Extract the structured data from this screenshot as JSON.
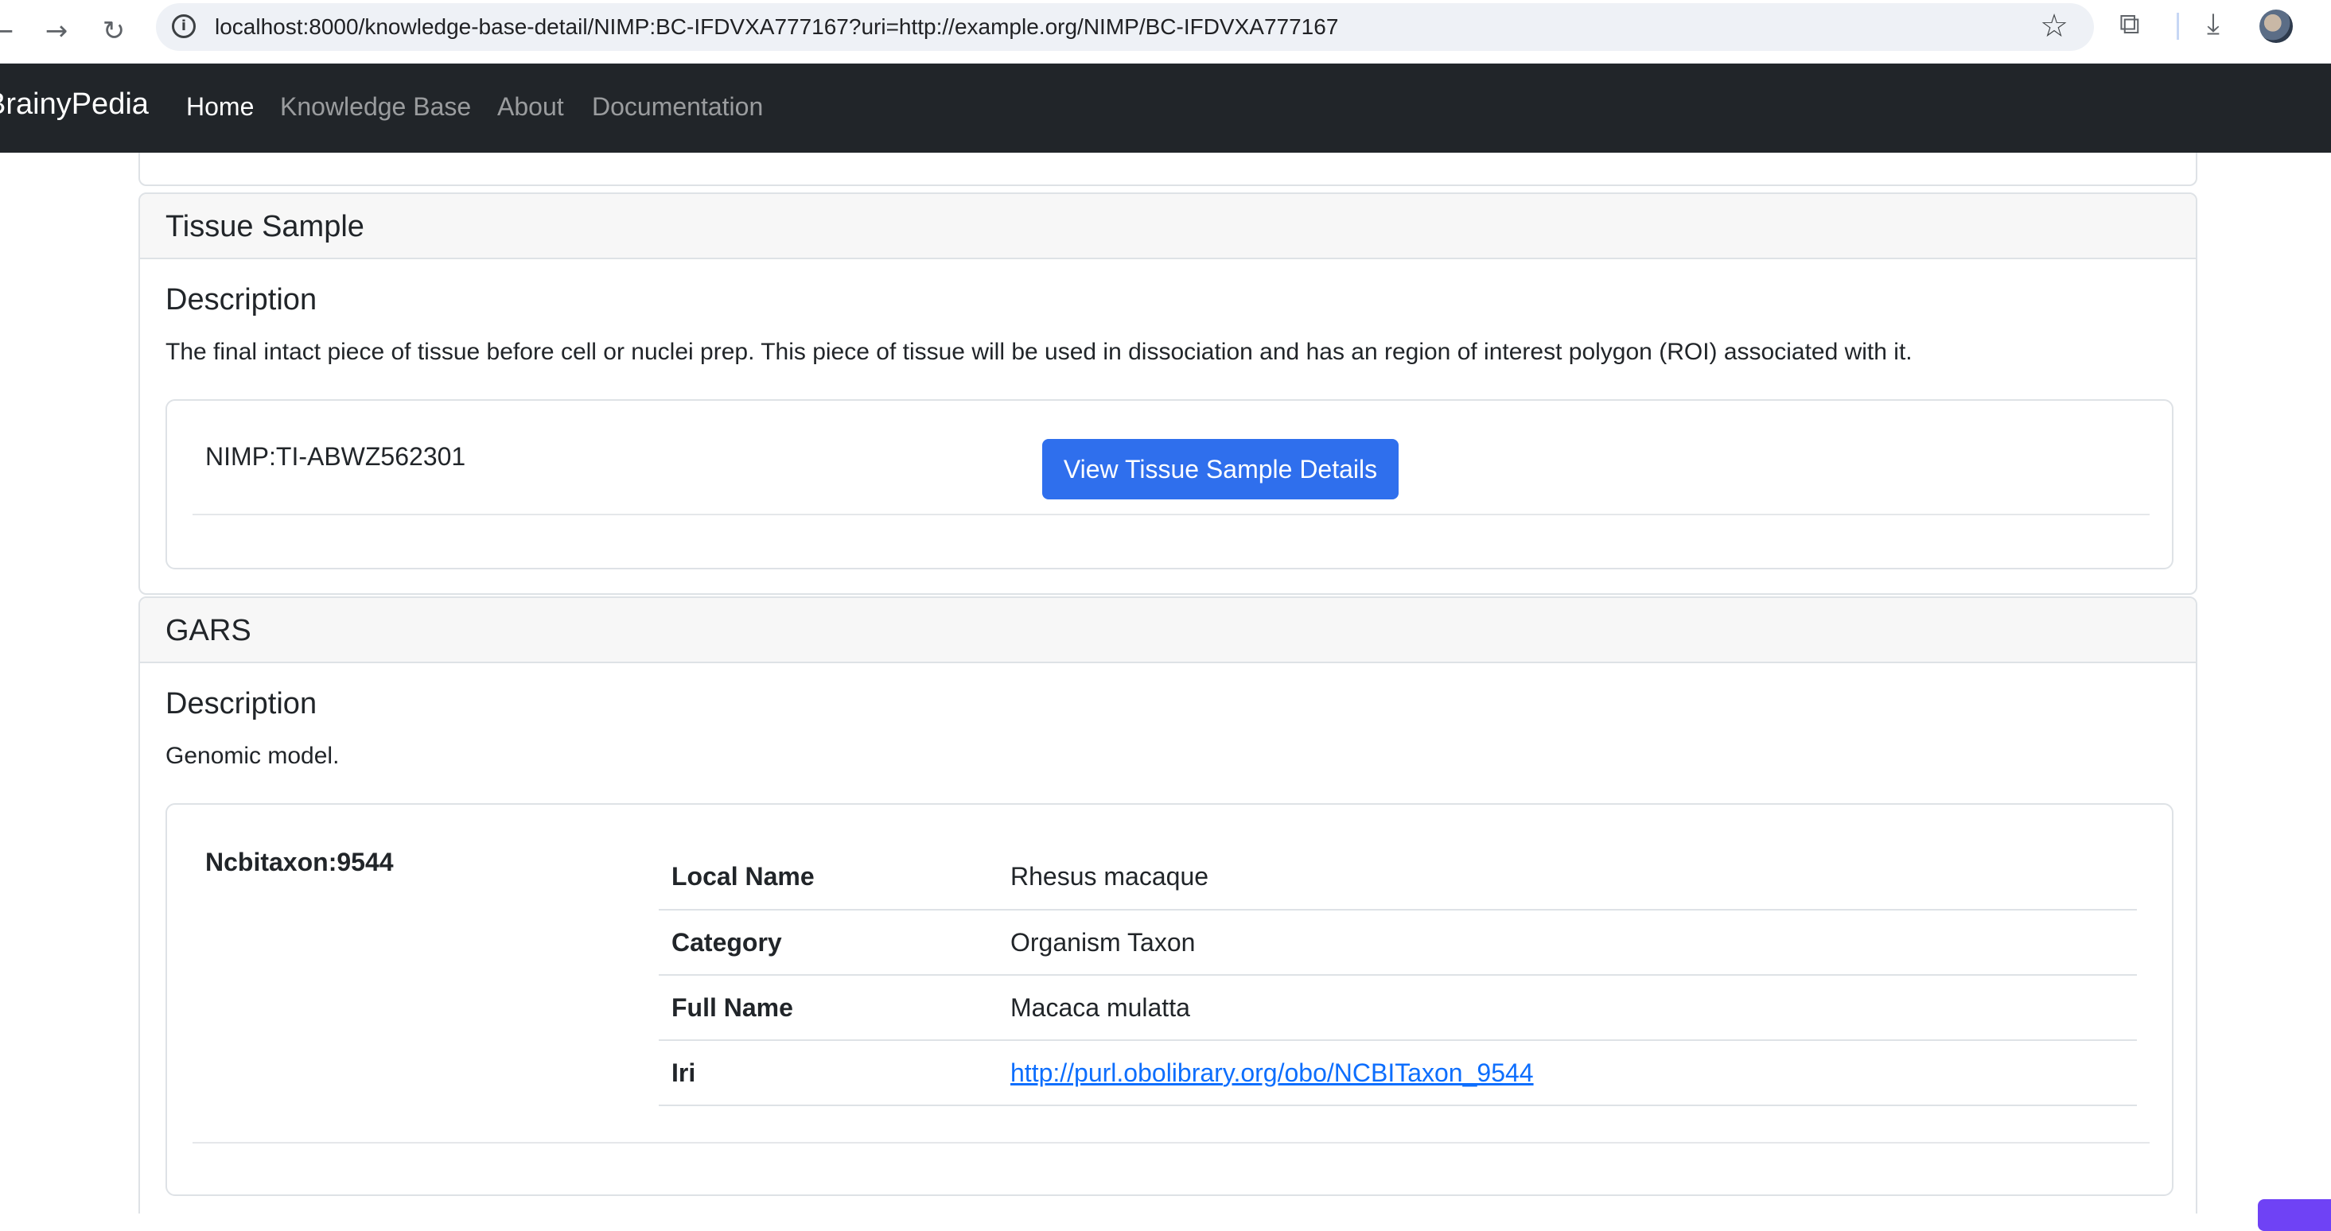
{
  "browser": {
    "url": "localhost:8000/knowledge-base-detail/NIMP:BC-IFDVXA777167?uri=http://example.org/NIMP/BC-IFDVXA777167",
    "back_icon": "←",
    "forward_icon": "→",
    "reload_icon": "↻",
    "info_icon": "i",
    "star_icon": "☆",
    "extensions_icon": "⧉",
    "download_icon": "⤓"
  },
  "navbar": {
    "brand": "BrainyPedia",
    "links": [
      "Home",
      "Knowledge Base",
      "About",
      "Documentation"
    ],
    "active": "Home"
  },
  "tissue_sample": {
    "header": "Tissue Sample",
    "description_title": "Description",
    "description": "The final intact piece of tissue before cell or nuclei prep. This piece of tissue will be used in dissociation and has an region of interest polygon (ROI) associated with it.",
    "item_id": "NIMP:TI-ABWZ562301",
    "button_label": "View Tissue Sample Details"
  },
  "gars": {
    "header": "GARS",
    "description_title": "Description",
    "description": "Genomic model.",
    "item_id": "Ncbitaxon:9544",
    "properties": [
      {
        "key": "Local Name",
        "value": "Rhesus macaque"
      },
      {
        "key": "Category",
        "value": "Organism Taxon"
      },
      {
        "key": "Full Name",
        "value": "Macaca mulatta"
      },
      {
        "key": "Iri",
        "value": "http://purl.obolibrary.org/obo/NCBITaxon_9544"
      }
    ]
  },
  "colors": {
    "navbar_bg": "#212529",
    "primary": "#2f6fed",
    "link": "#0d6efd"
  }
}
